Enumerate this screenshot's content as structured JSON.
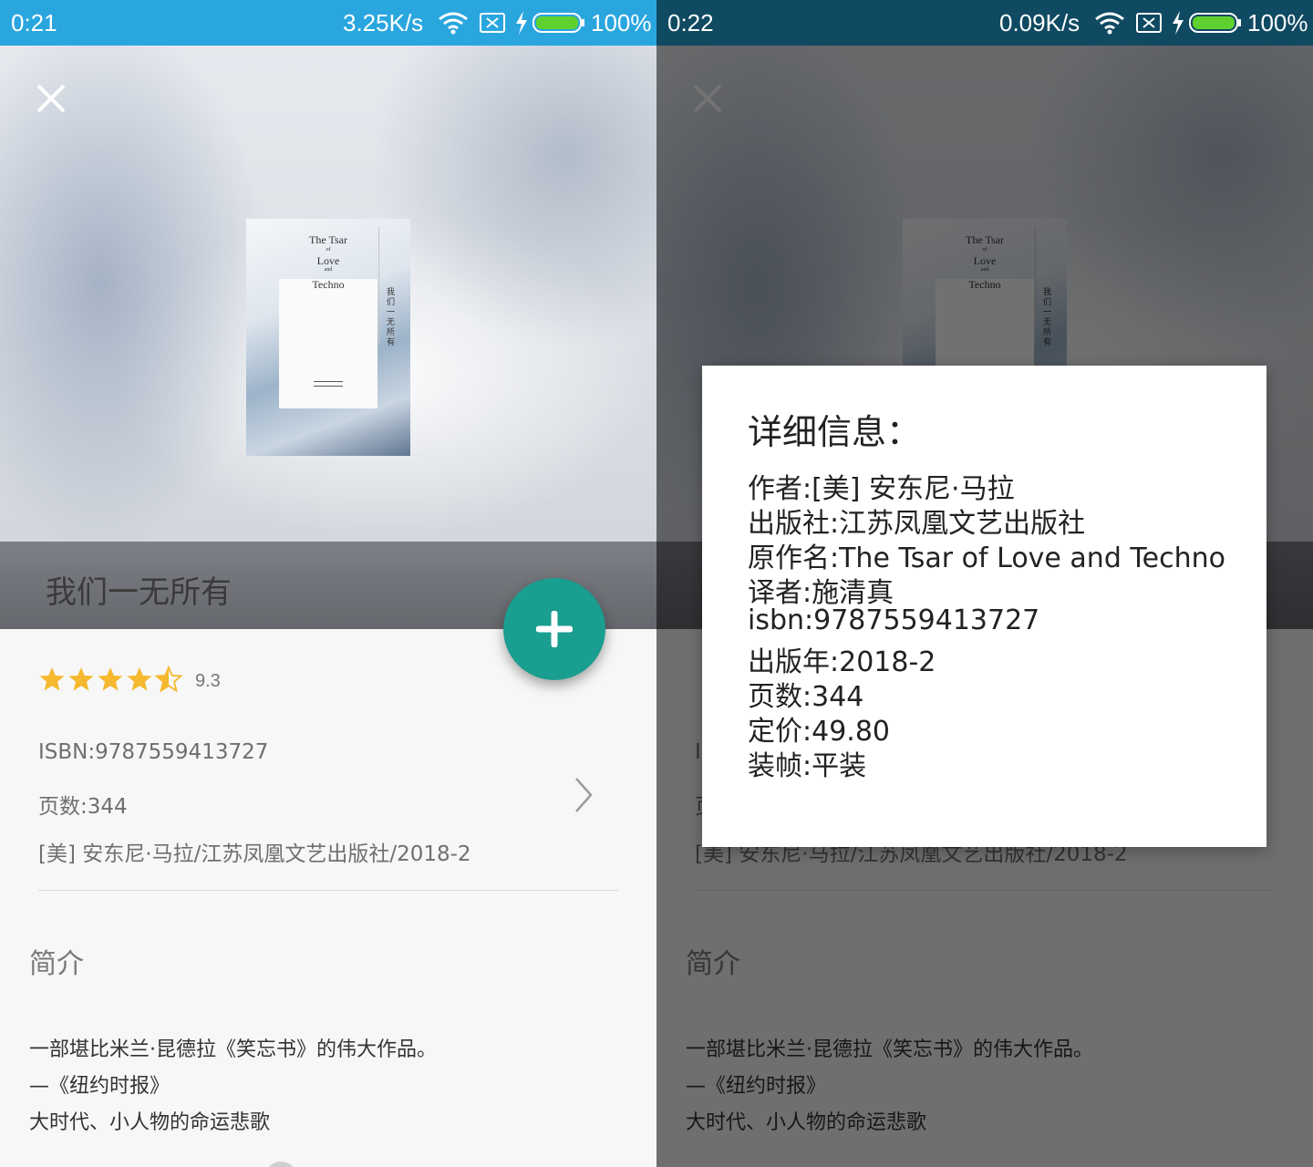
{
  "left": {
    "status_bar": {
      "time": "0:21",
      "speed": "3.25K/s",
      "battery": "100%"
    },
    "book": {
      "title": "我们一无所有",
      "cover": {
        "line1": "The Tsar",
        "line2": "of",
        "line3": "Love",
        "line4": "and",
        "line5": "Techno",
        "cn": "我们一无所有"
      },
      "rating_value": "9.3",
      "rating_stars": 4.5,
      "isbn_line": "ISBN:9787559413727",
      "pages_line": "页数:344",
      "author_pub_line": "[美] 安东尼·马拉/江苏凤凰文艺出版社/2018-2",
      "intro_heading": "简介",
      "intro_lines": [
        "一部堪比米兰·昆德拉《笑忘书》的伟大作品。",
        "—《纽约时报》",
        "大时代、小人物的命运悲歌"
      ]
    }
  },
  "right": {
    "status_bar": {
      "time": "0:22",
      "speed": "0.09K/s",
      "battery": "100%"
    },
    "dialog": {
      "title": "详细信息：",
      "lines": [
        "作者:[美] 安东尼·马拉",
        "出版社:江苏凤凰文艺出版社",
        "原作名:The Tsar of Love and Techno",
        "译者:施清真",
        "isbn:9787559413727",
        "出版年:2018-2",
        "页数:344",
        "定价:49.80",
        "装帧:平装"
      ]
    }
  },
  "colors": {
    "status_bar_left": "#2aa6df",
    "status_bar_right": "#0f4a62",
    "fab": "#1a9e8f",
    "star": "#f5b82e"
  },
  "icons": [
    "close-icon",
    "wifi-icon",
    "sim-icon",
    "charging-icon",
    "battery-icon",
    "add-icon",
    "star-icon",
    "chevron-right-icon"
  ]
}
